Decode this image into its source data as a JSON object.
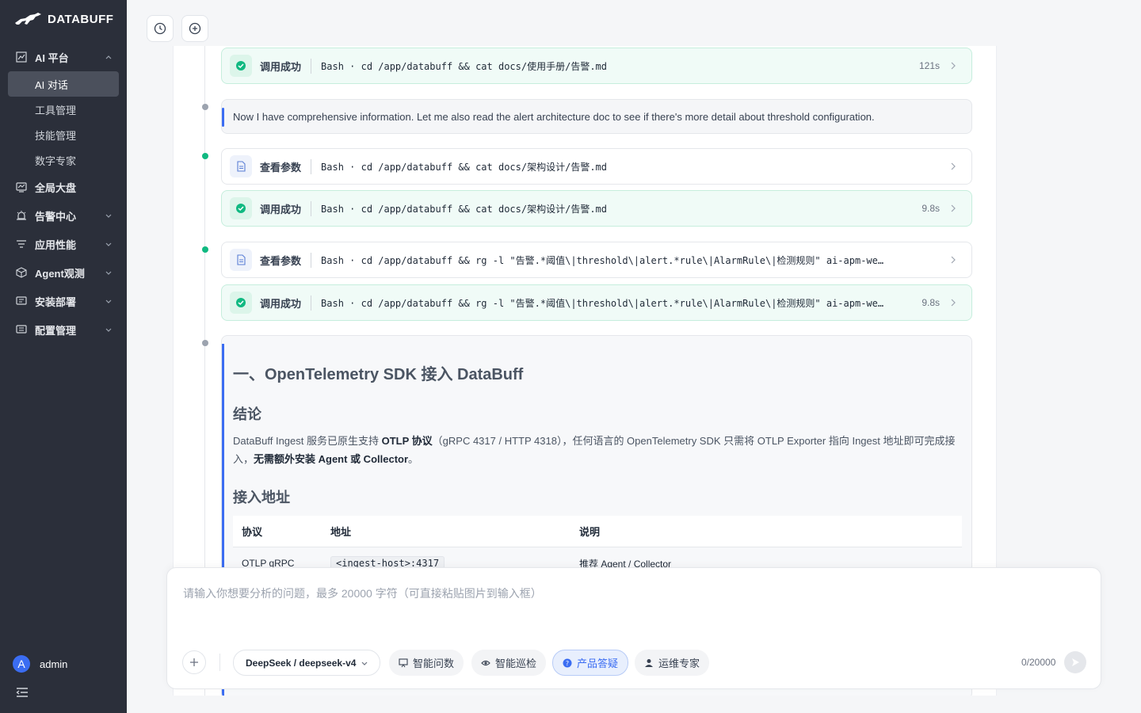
{
  "brand": {
    "name": "DATABUFF"
  },
  "sidebar": {
    "groups": [
      {
        "label": "AI 平台",
        "icon": "chart-icon",
        "expanded": true,
        "items": [
          "AI 对话",
          "工具管理",
          "技能管理",
          "数字专家"
        ]
      },
      {
        "label": "全局大盘",
        "icon": "dashboard-icon"
      },
      {
        "label": "告警中心",
        "icon": "alert-icon"
      },
      {
        "label": "应用性能",
        "icon": "apm-icon"
      },
      {
        "label": "Agent观测",
        "icon": "agent-icon"
      },
      {
        "label": "安装部署",
        "icon": "deploy-icon"
      },
      {
        "label": "配置管理",
        "icon": "config-icon"
      }
    ],
    "active_item": "AI 对话",
    "user": {
      "avatar_letter": "A",
      "name": "admin"
    }
  },
  "chat": {
    "cards": [
      {
        "title": "调用成功",
        "command": "Bash · cd /app/databuff && cat docs/使用手册/告警.md",
        "time": "121s"
      },
      {
        "note": "Now I have comprehensive information. Let me also read the alert architecture doc to see if there's more detail about threshold configuration."
      },
      {
        "title": "查看参数",
        "command": "Bash · cd /app/databuff && cat docs/架构设计/告警.md",
        "time": ""
      },
      {
        "title": "调用成功",
        "command": "Bash · cd /app/databuff && cat docs/架构设计/告警.md",
        "time": "9.8s"
      },
      {
        "title": "查看参数",
        "command": "Bash · cd /app/databuff && rg -l \"告警.*阈值\\|threshold\\|alert.*rule\\|AlarmRule\\|检测规则\" ai-apm-we…",
        "time": ""
      },
      {
        "title": "调用成功",
        "command": "Bash · cd /app/databuff && rg -l \"告警.*阈值\\|threshold\\|alert.*rule\\|AlarmRule\\|检测规则\" ai-apm-we…",
        "time": "9.8s"
      }
    ],
    "doc": {
      "h1": "一、OpenTelemetry SDK 接入 DataBuff",
      "h2_conclusion": "结论",
      "para_p1": "DataBuff Ingest 服务已原生支持 ",
      "para_b1": "OTLP 协议",
      "para_p2": "（gRPC 4317 / HTTP 4318），任何语言的 OpenTelemetry SDK 只需将 OTLP Exporter 指向 Ingest 地址即可完成接入，",
      "para_b2": "无需额外安装 Agent 或 Collector",
      "para_p3": "。",
      "h2_address": "接入地址",
      "table": {
        "headers": [
          "协议",
          "地址",
          "说明"
        ],
        "rows": [
          [
            "OTLP gRPC",
            "<ingest-host>:4317",
            "推荐 Agent / Collector"
          ]
        ]
      }
    }
  },
  "input": {
    "placeholder": "请输入你想要分析的问题，最多 20000 字符（可直接粘贴图片到输入框）",
    "model": "DeepSeek / deepseek-v4",
    "modes": [
      "智能问数",
      "智能巡检",
      "产品答疑",
      "运维专家"
    ],
    "active_mode": "产品答疑",
    "counter": "0/20000"
  },
  "colors": {
    "accent": "#3b6df2",
    "success": "#10b981",
    "sidebar_bg": "#2b2f3a"
  }
}
